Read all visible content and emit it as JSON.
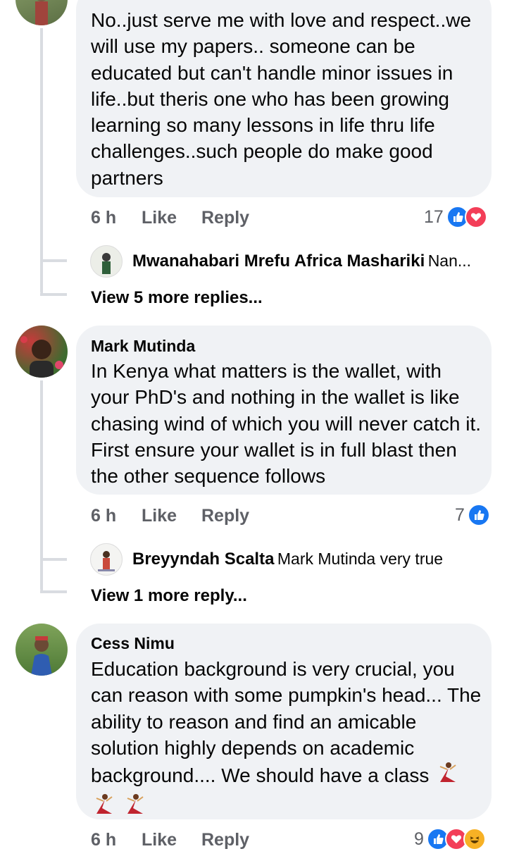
{
  "comments": [
    {
      "text": "No..just serve me with love and respect..we will use my papers.. someone can be educated but can't handle minor issues in life..but theris one who has been growing learning so many lessons in life thru life challenges..such people do make good partners",
      "time": "6 h",
      "like_label": "Like",
      "reply_label": "Reply",
      "reaction_count": "17",
      "reactions": [
        "like",
        "love"
      ],
      "reply_preview": {
        "name": "Mwanahabari Mrefu Africa Mashariki",
        "text": "Nan..."
      },
      "view_more": "View 5 more replies..."
    },
    {
      "name": "Mark Mutinda",
      "text": "In Kenya what matters is the wallet, with your PhD's and nothing in the wallet is like chasing wind of which you will never catch it. First ensure your wallet is in full blast then the other sequence follows",
      "time": "6 h",
      "like_label": "Like",
      "reply_label": "Reply",
      "reaction_count": "7",
      "reactions": [
        "like"
      ],
      "reply_preview": {
        "name": "Breyyndah Scalta",
        "text": "Mark Mutinda very true"
      },
      "view_more": "View 1 more reply..."
    },
    {
      "name": "Cess Nimu",
      "text": "Education background is very crucial, you can reason with some pumpkin's head... The ability to reason and find an amicable solution highly depends on academic background.... We should have a class",
      "emoji": [
        "dancer",
        "dancer",
        "dancer"
      ],
      "time": "6 h",
      "like_label": "Like",
      "reply_label": "Reply",
      "reaction_count": "9",
      "reactions": [
        "like",
        "love",
        "haha"
      ]
    }
  ]
}
